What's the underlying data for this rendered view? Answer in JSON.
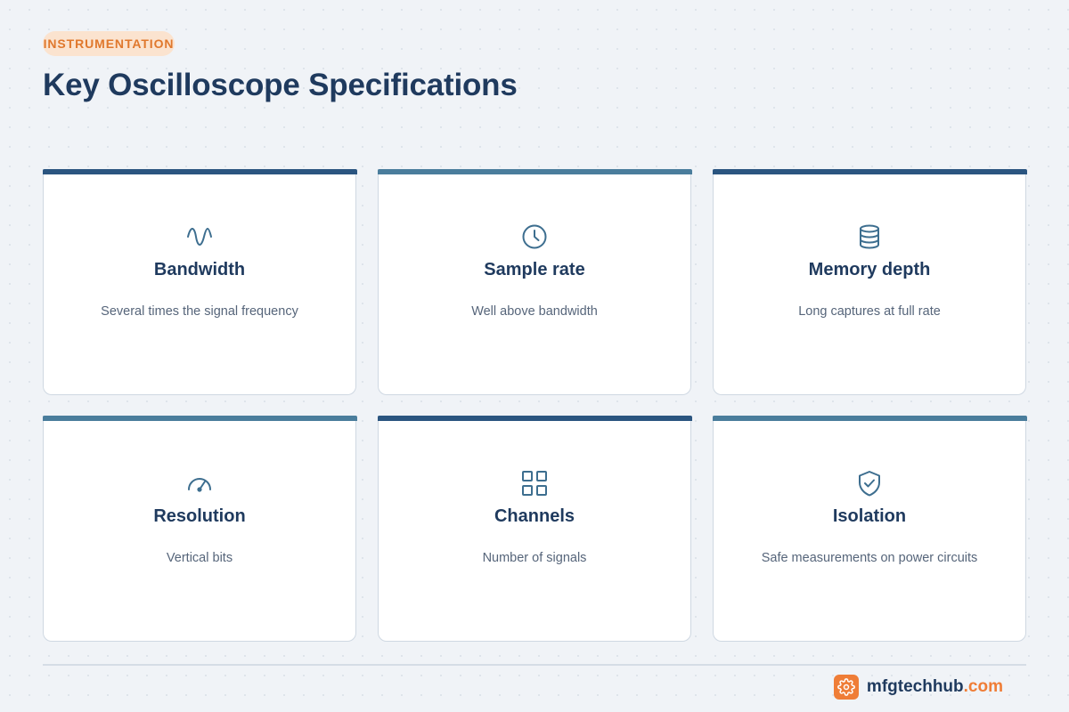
{
  "header": {
    "category": "INSTRUMENTATION",
    "title": "Key Oscilloscope Specifications"
  },
  "colors": {
    "accent": "#ef7d37",
    "navy": "#1f3a5e",
    "bar_dark": "#2b5580",
    "bar_light": "#4a7d9c"
  },
  "cards": [
    {
      "title": "Bandwidth",
      "description": "Several times the signal frequency",
      "icon": "sine-wave-icon"
    },
    {
      "title": "Sample rate",
      "description": "Well above bandwidth",
      "icon": "clock-icon"
    },
    {
      "title": "Memory depth",
      "description": "Long captures at full rate",
      "icon": "database-icon"
    },
    {
      "title": "Resolution",
      "description": "Vertical bits",
      "icon": "gauge-icon"
    },
    {
      "title": "Channels",
      "description": "Number of signals",
      "icon": "grid-icon"
    },
    {
      "title": "Isolation",
      "description": "Safe measurements on power circuits",
      "icon": "shield-check-icon"
    }
  ],
  "footer": {
    "brand_name": "mfgtechhub",
    "brand_tld": ".com",
    "logo_icon": "gear-icon"
  }
}
